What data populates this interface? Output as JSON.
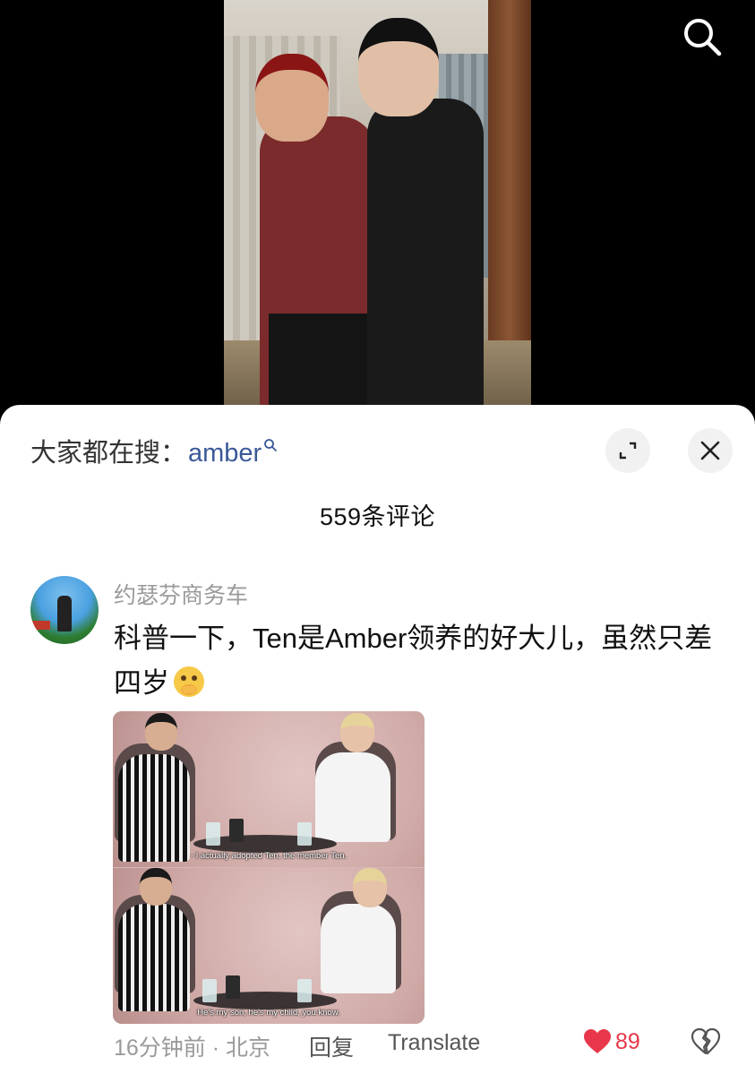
{
  "video": {
    "search_icon": "search-icon"
  },
  "sheet": {
    "hot_search_prefix": "大家都在搜：",
    "hot_search_term": "amber",
    "expand_icon": "expand-icon",
    "close_icon": "close-icon",
    "comment_count": "559条评论"
  },
  "comment": {
    "username": "约瑟芬商务车",
    "text": "科普一下，Ten是Amber领养的好大儿，虽然只差四岁",
    "emoji": "hand-over-mouth-emoji",
    "image": {
      "subtitle_top": "- I actually adopted Ten, the member Ten.",
      "subtitle_bottom": "He's my son, he's my child, you know."
    },
    "time_location": "16分钟前 · 北京",
    "reply_label": "回复",
    "translate_label": "Translate",
    "like_count": "89"
  },
  "colors": {
    "accent_link": "#3b5998",
    "like_red": "#e8374a"
  }
}
